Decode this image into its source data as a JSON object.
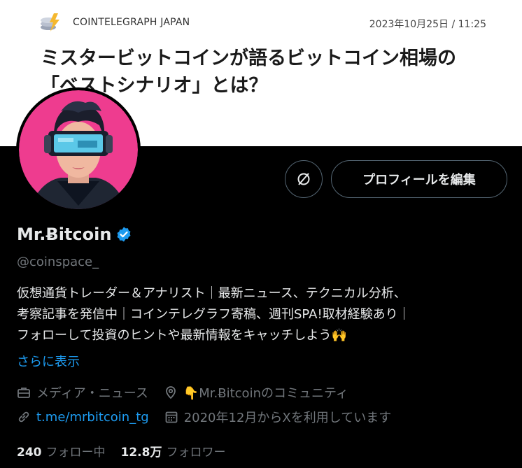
{
  "banner": {
    "brand": "COINTELEGRAPH JAPAN",
    "date": "2023年10月25日 / 11:25",
    "headline_line1": "ミスタービットコインが語るビットコイン相場の",
    "headline_line2": "「ベストシナリオ」とは？"
  },
  "profile": {
    "display_name": "Mr.Ƀitcoin",
    "handle": "@coinspace_",
    "bio_lines": [
      "仮想通貨トレーダー＆アナリスト｜最新ニュース、テクニカル分析、",
      "考察記事を発信中｜コインテレグラフ寄稿、週刊SPA!取材経験あり｜",
      "フォローして投資のヒントや最新情報をキャッチしよう🙌"
    ],
    "see_more": "さらに表示",
    "edit_button": "プロフィールを編集",
    "category": "メディア・ニュース",
    "location": "👇Mr.Ƀitcoinのコミュニティ",
    "website": "t.me/mrbitcoin_tg",
    "joined": "2020年12月からXを利用しています",
    "following_count": "240",
    "following_label": "フォロー中",
    "followers_count": "12.8万",
    "followers_label": "フォロワー"
  },
  "colors": {
    "background": "#000000",
    "text": "#e7e9ea",
    "muted": "#71767b",
    "accent": "#1d9bf0",
    "avatar_bg": "#ee3c8f"
  },
  "icons": [
    "cointelegraph-logo-icon",
    "verified-badge-icon",
    "refresh-icon",
    "briefcase-icon",
    "location-pin-icon",
    "link-icon",
    "calendar-icon"
  ]
}
